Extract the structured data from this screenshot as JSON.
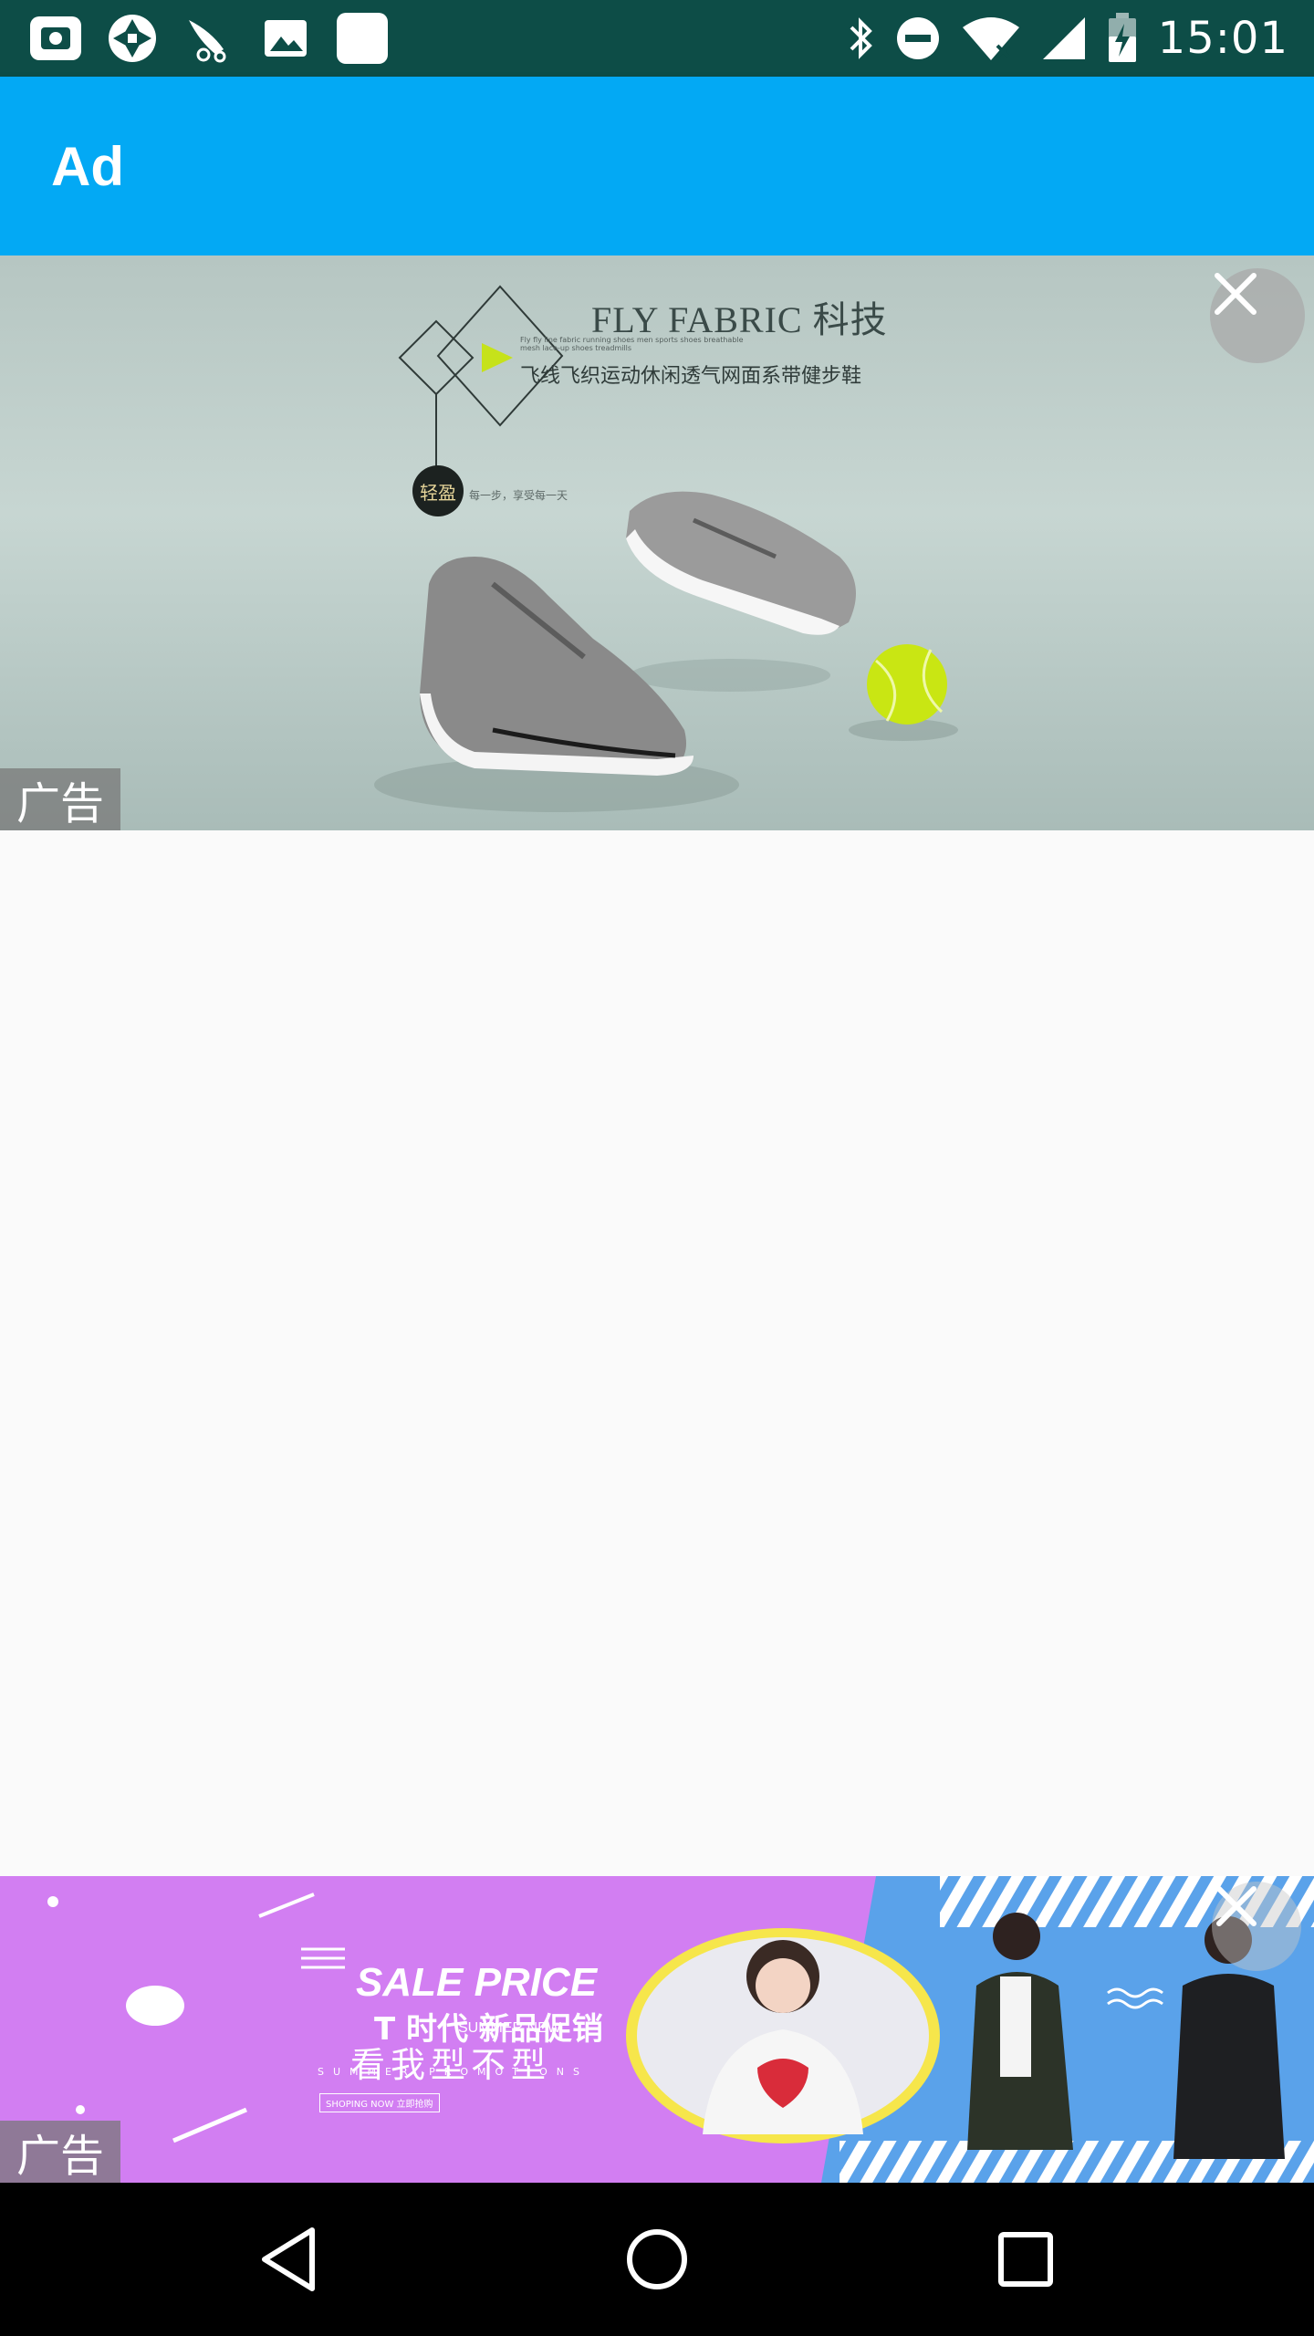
{
  "status_bar": {
    "time": "15:01",
    "left_icons": [
      "camera-app-icon",
      "aperture-app-icon",
      "bird-app-icon",
      "image-icon",
      "square-app-icon"
    ],
    "right_icons": [
      "bluetooth-icon",
      "do-not-disturb-icon",
      "wifi-icon",
      "cell-signal-icon",
      "battery-charging-icon"
    ]
  },
  "app_bar": {
    "title": "Ad"
  },
  "top_ad": {
    "headline": "FLY FABRIC 科技",
    "subtitle": "飞线飞织运动休闲透气网面系带健步鞋",
    "tiny_text": "Fly fly line fabric running shoes men sports shoes breathable mesh lace-up shoes treadmills",
    "badge": "轻盈",
    "badge_caption": "每一步，享受每一天",
    "label": "广告"
  },
  "bottom_ad": {
    "title": "SALE PRICE",
    "main": "T 时代 新品促销",
    "english": "SUMMER NEW",
    "slogan": "看我型不型",
    "small": "SUMMER PROMOTIONS",
    "button": "SHOPING NOW 立即抢购",
    "label": "广告"
  },
  "nav_bar": {
    "buttons": [
      "back",
      "home",
      "recents"
    ]
  },
  "colors": {
    "status_bar": "#0d4d47",
    "app_bar": "#03a9f4",
    "background": "#fafafa",
    "bottom_ad": "#d27ef2"
  }
}
